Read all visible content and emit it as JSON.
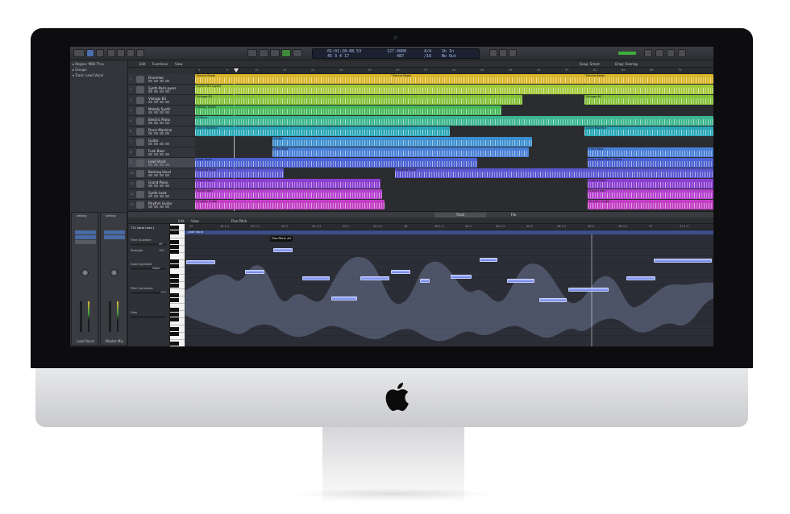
{
  "app": {
    "control_bar": {
      "lcd_position": "01:01:28:08.53",
      "lcd_bars": "45  3  4  17",
      "lcd_tempo": "127.0000",
      "lcd_tempo_sub": "487",
      "lcd_signature": "4/4",
      "lcd_division": "/16",
      "lcd_key": "Sh In",
      "lcd_out": "No Out"
    },
    "inspector": {
      "rows": [
        "▸ Region: MIDI Thru",
        "▸ Groups",
        "▾ Track: Lead Vocal"
      ],
      "strip_left": {
        "label": "Lead Vocal",
        "buttons": [
          "Setting",
          "Channel EQ",
          "Compressor",
          "Bus 1",
          "Read"
        ]
      },
      "strip_right": {
        "label": "Master Mix",
        "buttons": [
          "Setting",
          "Channel EQ",
          "Compressor",
          "Read"
        ]
      }
    },
    "tracks_toolbar": {
      "edit": "Edit",
      "functions": "Functions",
      "view": "View",
      "snap": "Snap: Smart",
      "drag": "Drag: Overlap"
    },
    "ruler_marks": [
      "5",
      "9",
      "13",
      "17",
      "21",
      "25",
      "29",
      "33",
      "37",
      "41",
      "45",
      "49",
      "53",
      "57",
      "61",
      "65",
      "69",
      "73"
    ],
    "tracks": [
      {
        "num": "1",
        "name": "Drummer",
        "color": "#d9b52a"
      },
      {
        "num": "2",
        "name": "Synth Pad Layers",
        "color": "#a4c93a"
      },
      {
        "num": "3",
        "name": "Vintage B3",
        "color": "#84c23a"
      },
      {
        "num": "4",
        "name": "Melody Synth",
        "color": "#47b85a"
      },
      {
        "num": "5",
        "name": "Electric Piano",
        "color": "#3ab58d"
      },
      {
        "num": "6",
        "name": "Drum Machine",
        "color": "#2aa6b5"
      },
      {
        "num": "7",
        "name": "Guitar",
        "color": "#3c8fd0"
      },
      {
        "num": "8",
        "name": "Funk Bass",
        "color": "#4a7fd6"
      },
      {
        "num": "9",
        "name": "Lead Vocal",
        "color": "#4d62d2"
      },
      {
        "num": "10",
        "name": "Backing Vocal",
        "color": "#5b56d0"
      },
      {
        "num": "11",
        "name": "Grand Piano",
        "color": "#8a3fd0"
      },
      {
        "num": "12",
        "name": "Synth Lead",
        "color": "#b542cf"
      },
      {
        "num": "13",
        "name": "Rhythm Guitar",
        "color": "#c23fc4"
      }
    ],
    "region_names": {
      "drummer_a": "Electro Beats",
      "drummer_b": "Electro Beats",
      "drummer_c": "Electro Beats",
      "pad": "Synth Pad Layers",
      "b3": "Vintage B3",
      "b3_b": "Vintage B3",
      "melody": "Melody Synth",
      "epiano": "E.Piano",
      "drum_machine": "Drum Machine",
      "drum_machine_b": "Drum Machine",
      "guitar": "Guitar",
      "funk": "Funk Bass",
      "funk_b": "Funk Bass",
      "lead": "Lead Vocal",
      "lead_b": "Lead Vocal Pitch Comp",
      "backing": "Backing Vocal",
      "backing_b": "Backing Vocal",
      "grand": "Grand Piano",
      "grand_b": "Grand Piano",
      "synthlead": "Synth Lead",
      "synthlead_b": "Synth Lead",
      "rhythm": "Rhythm Guitar",
      "rhythm_b": "Rhythm Guitar"
    },
    "editor_tabs": {
      "track": "Track",
      "file": "File"
    },
    "editor_toolbar": {
      "edit": "Edit",
      "view": "View",
      "mode": "Flex Pitch"
    },
    "editor_inspector": {
      "region": "T13 Vocal Lead 1",
      "time_quantize": "Time Quantize",
      "time_quantize_val": "off",
      "strength": "Strength",
      "strength_val": "100",
      "scale_quantize": "Scale Quantize",
      "scale_quantize_val": "Major",
      "pitch_correction": "Pitch Correction",
      "pitch_correction_val": "100",
      "gain": "Gain"
    },
    "editor_ruler": [
      "45",
      "45.1.3",
      "45.2.3",
      "45.3",
      "45.3.3",
      "45.4",
      "45.4.3",
      "46",
      "46.1.3",
      "46.2",
      "46.2.3",
      "46.3",
      "46.3.3",
      "46.4",
      "46.4.3",
      "47",
      "47.1.3"
    ],
    "editor_region": "Lead Vocal",
    "flex_tooltip": "Flex Pitch: A4"
  }
}
